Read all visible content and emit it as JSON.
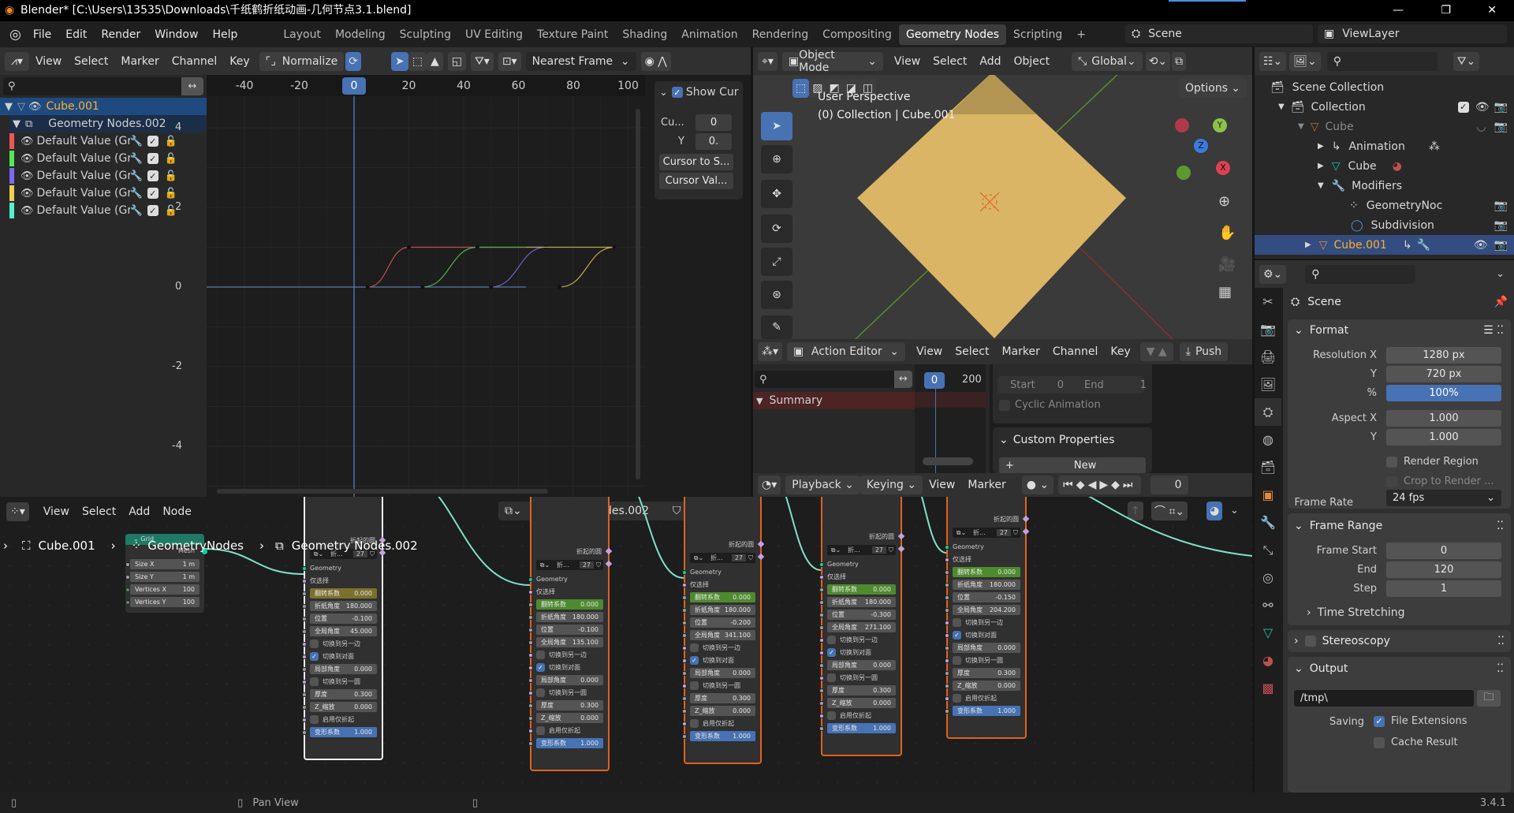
{
  "window": {
    "title": "Blender* [C:\\Users\\13535\\Downloads\\千纸鹤折纸动画-几何节点3.1.blend]"
  },
  "menu": {
    "items": [
      "File",
      "Edit",
      "Render",
      "Window",
      "Help"
    ]
  },
  "workspaces": {
    "tabs": [
      "Layout",
      "Modeling",
      "Sculpting",
      "UV Editing",
      "Texture Paint",
      "Shading",
      "Animation",
      "Rendering",
      "Compositing",
      "Geometry Nodes",
      "Scripting"
    ],
    "active": "Geometry Nodes",
    "add": "+"
  },
  "scene": {
    "name": "Scene",
    "view_layer": "ViewLayer"
  },
  "graph_editor": {
    "menus": [
      "View",
      "Select",
      "Marker",
      "Channel",
      "Key"
    ],
    "normalize": "Normalize",
    "auto_snap": "Nearest Frame",
    "object": "Cube.001",
    "action": "Geometry Nodes.002",
    "channels": [
      {
        "label": "Default Value (Group",
        "color": "#f05454"
      },
      {
        "label": "Default Value (Group",
        "color": "#54e854"
      },
      {
        "label": "Default Value (Group",
        "color": "#7a6cf0"
      },
      {
        "label": "Default Value (Group",
        "color": "#f0d054"
      },
      {
        "label": "Default Value (Group",
        "color": "#54f0d0"
      }
    ],
    "current_frame": "0",
    "x_ticks": [
      "-40",
      "-20",
      "0",
      "20",
      "40",
      "60",
      "80",
      "100"
    ],
    "y_ticks": [
      "4",
      "2",
      "0",
      "-2",
      "-4"
    ],
    "curves": [
      {
        "color": "#c05050",
        "keys": [
          [
            5,
            0
          ],
          [
            20,
            1
          ]
        ]
      },
      {
        "color": "#50b050",
        "keys": [
          [
            25,
            0
          ],
          [
            45,
            1
          ]
        ]
      },
      {
        "color": "#6a60c8",
        "keys": [
          [
            50,
            0
          ],
          [
            70,
            1
          ]
        ]
      },
      {
        "color": "#c0a850",
        "keys": [
          [
            75,
            0
          ],
          [
            95,
            1
          ]
        ]
      }
    ],
    "sidebar": {
      "show_cursor": "Show Cur",
      "cursor_x_label": "Cu...",
      "cursor_x": "0",
      "cursor_y_label": "Y",
      "cursor_y": "0.",
      "cursor_to_selected": "Cursor to S...",
      "cursor_value": "Cursor Val..."
    }
  },
  "viewport": {
    "mode": "Object Mode",
    "menus": [
      "View",
      "Select",
      "Add",
      "Object"
    ],
    "orientation": "Global",
    "options": "Options",
    "overlay_line1": "User Perspective",
    "overlay_line2": "(0) Collection | Cube.001",
    "gizmo": {
      "x": "X",
      "y": "Y",
      "z": "Z"
    }
  },
  "action_editor": {
    "mode": "Action Editor",
    "menus": [
      "View",
      "Select",
      "Marker",
      "Channel",
      "Key"
    ],
    "push_down": "Push",
    "frame_current": "0",
    "frame_end_tick": "200",
    "summary": "Summary",
    "start_label": "Start",
    "start": "0",
    "end_label": "End",
    "end": "1",
    "cyclic": "Cyclic Animation",
    "custom_properties": "Custom Properties",
    "new": "New"
  },
  "timeline": {
    "playback": "Playback",
    "keying": "Keying",
    "view": "View",
    "marker": "Marker",
    "frame": "0"
  },
  "node_editor": {
    "menus": [
      "View",
      "Select",
      "Add",
      "Node"
    ],
    "tree": "Geometry Nodes.002",
    "breadcrumb": [
      "Cube.001",
      "GeometryNodes",
      "Geometry Nodes.002"
    ],
    "grid_node": {
      "title": "Grid",
      "output": "Mesh",
      "rows": [
        [
          "Size X",
          "1 m"
        ],
        [
          "Size Y",
          "1 m"
        ],
        [
          "Vertices X",
          "100"
        ],
        [
          "Vertices Y",
          "100"
        ]
      ]
    },
    "groups": [
      {
        "outputs": [
          "折起的圆",
          "未折起的圆"
        ],
        "group": "折...",
        "users": "27",
        "flip_color": "#7d702d",
        "values": [
          "0.000",
          "180.000",
          "-0.100",
          "45.000",
          false,
          true,
          "0.000",
          false,
          "0.300",
          "0.000",
          false,
          "1.000"
        ]
      },
      {
        "outputs": [
          "折起的圆",
          "未折起的圆"
        ],
        "group": "折...",
        "users": "27",
        "flip_color": "#4e8a2e",
        "values": [
          "0.000",
          "180.000",
          "-0.100",
          "135.100",
          false,
          true,
          "0.000",
          false,
          "0.300",
          "0.000",
          false,
          "1.000"
        ]
      },
      {
        "outputs": [
          "折起的圆",
          "未折起的圆"
        ],
        "group": "折...",
        "users": "27",
        "flip_color": "#4e8a2e",
        "values": [
          "0.000",
          "180.000",
          "-0.200",
          "341.100",
          false,
          true,
          "0.000",
          false,
          "0.300",
          "0.000",
          false,
          "1.000"
        ]
      },
      {
        "outputs": [
          "折起的圆",
          "未折起的圆"
        ],
        "group": "折...",
        "users": "27",
        "flip_color": "#4e8a2e",
        "values": [
          "0.000",
          "180.000",
          "-0.300",
          "271.100",
          false,
          true,
          "0.000",
          false,
          "0.300",
          "0.000",
          false,
          "1.000"
        ]
      },
      {
        "outputs": [
          "折起的圆",
          "未折起的圆"
        ],
        "group": "折...",
        "users": "27",
        "flip_color": "#4e8a2e",
        "values": [
          "0.000",
          "180.000",
          "-0.150",
          "204.200",
          false,
          true,
          "0.000",
          false,
          "0.300",
          "0.000",
          false,
          "1.000"
        ]
      }
    ],
    "inputs": [
      "Geometry",
      "仅选择",
      "翻转系数",
      "折纸角度",
      "位置",
      "全局角度",
      "切换到另一边",
      "切换到对面",
      "局部角度",
      "切换到另一圆",
      "厚度",
      "Z_缩放",
      "启用仅折起",
      "变形系数"
    ]
  },
  "outliner": {
    "items": [
      {
        "label": "Scene Collection"
      },
      {
        "label": "Collection"
      },
      {
        "label": "Cube"
      },
      {
        "label": "Animation"
      },
      {
        "label": "Cube"
      },
      {
        "label": "Modifiers"
      },
      {
        "label": "GeometryNoc"
      },
      {
        "label": "Subdivision"
      },
      {
        "label": "Cube.001"
      }
    ]
  },
  "properties": {
    "context": "Scene",
    "format": {
      "title": "Format",
      "res_x_label": "Resolution X",
      "res_x": "1280 px",
      "res_y_label": "Y",
      "res_y": "720 px",
      "pct_label": "%",
      "pct": "100%",
      "aspect_x_label": "Aspect X",
      "aspect_x": "1.000",
      "aspect_y_label": "Y",
      "aspect_y": "1.000",
      "render_region": "Render Region",
      "crop": "Crop to Render ...",
      "frame_rate_label": "Frame Rate",
      "frame_rate": "24 fps"
    },
    "frame_range": {
      "title": "Frame Range",
      "start_label": "Frame Start",
      "start": "0",
      "end_label": "End",
      "end": "120",
      "step_label": "Step",
      "step": "1",
      "time_stretching": "Time Stretching"
    },
    "stereoscopy": "Stereoscopy",
    "output": {
      "title": "Output",
      "path": "/tmp\\",
      "saving_label": "Saving",
      "file_extensions": "File Extensions",
      "cache_result": "Cache Result"
    }
  },
  "status": {
    "action": "Pan View",
    "version": "3.4.1"
  },
  "colors": {
    "accent": "#4772b3",
    "selection_orange": "#e0621d",
    "socket_geometry": "#00d6a3",
    "mesh_face": "#d9b565"
  }
}
